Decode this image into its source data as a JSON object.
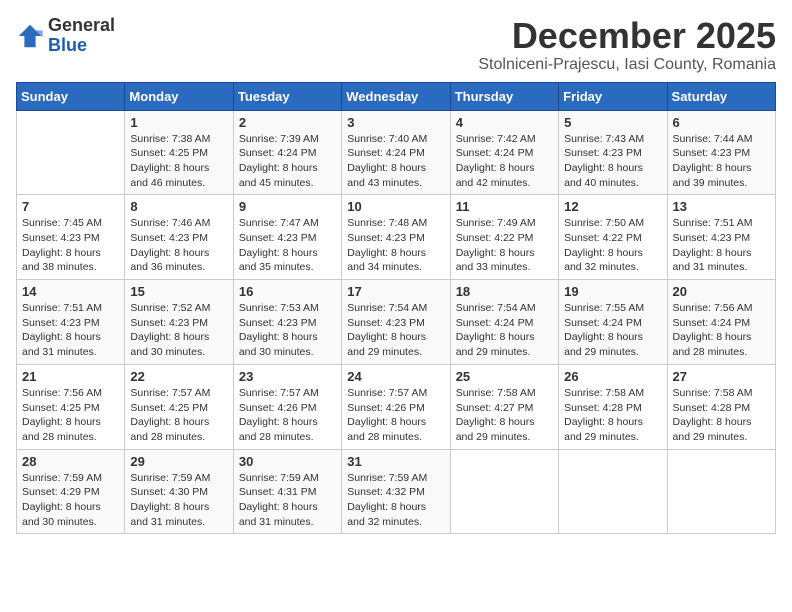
{
  "header": {
    "logo_general": "General",
    "logo_blue": "Blue",
    "month": "December 2025",
    "location": "Stolniceni-Prajescu, Iasi County, Romania"
  },
  "days_of_week": [
    "Sunday",
    "Monday",
    "Tuesday",
    "Wednesday",
    "Thursday",
    "Friday",
    "Saturday"
  ],
  "weeks": [
    [
      {
        "day": "",
        "info": ""
      },
      {
        "day": "1",
        "info": "Sunrise: 7:38 AM\nSunset: 4:25 PM\nDaylight: 8 hours\nand 46 minutes."
      },
      {
        "day": "2",
        "info": "Sunrise: 7:39 AM\nSunset: 4:24 PM\nDaylight: 8 hours\nand 45 minutes."
      },
      {
        "day": "3",
        "info": "Sunrise: 7:40 AM\nSunset: 4:24 PM\nDaylight: 8 hours\nand 43 minutes."
      },
      {
        "day": "4",
        "info": "Sunrise: 7:42 AM\nSunset: 4:24 PM\nDaylight: 8 hours\nand 42 minutes."
      },
      {
        "day": "5",
        "info": "Sunrise: 7:43 AM\nSunset: 4:23 PM\nDaylight: 8 hours\nand 40 minutes."
      },
      {
        "day": "6",
        "info": "Sunrise: 7:44 AM\nSunset: 4:23 PM\nDaylight: 8 hours\nand 39 minutes."
      }
    ],
    [
      {
        "day": "7",
        "info": "Sunrise: 7:45 AM\nSunset: 4:23 PM\nDaylight: 8 hours\nand 38 minutes."
      },
      {
        "day": "8",
        "info": "Sunrise: 7:46 AM\nSunset: 4:23 PM\nDaylight: 8 hours\nand 36 minutes."
      },
      {
        "day": "9",
        "info": "Sunrise: 7:47 AM\nSunset: 4:23 PM\nDaylight: 8 hours\nand 35 minutes."
      },
      {
        "day": "10",
        "info": "Sunrise: 7:48 AM\nSunset: 4:23 PM\nDaylight: 8 hours\nand 34 minutes."
      },
      {
        "day": "11",
        "info": "Sunrise: 7:49 AM\nSunset: 4:22 PM\nDaylight: 8 hours\nand 33 minutes."
      },
      {
        "day": "12",
        "info": "Sunrise: 7:50 AM\nSunset: 4:22 PM\nDaylight: 8 hours\nand 32 minutes."
      },
      {
        "day": "13",
        "info": "Sunrise: 7:51 AM\nSunset: 4:23 PM\nDaylight: 8 hours\nand 31 minutes."
      }
    ],
    [
      {
        "day": "14",
        "info": "Sunrise: 7:51 AM\nSunset: 4:23 PM\nDaylight: 8 hours\nand 31 minutes."
      },
      {
        "day": "15",
        "info": "Sunrise: 7:52 AM\nSunset: 4:23 PM\nDaylight: 8 hours\nand 30 minutes."
      },
      {
        "day": "16",
        "info": "Sunrise: 7:53 AM\nSunset: 4:23 PM\nDaylight: 8 hours\nand 30 minutes."
      },
      {
        "day": "17",
        "info": "Sunrise: 7:54 AM\nSunset: 4:23 PM\nDaylight: 8 hours\nand 29 minutes."
      },
      {
        "day": "18",
        "info": "Sunrise: 7:54 AM\nSunset: 4:24 PM\nDaylight: 8 hours\nand 29 minutes."
      },
      {
        "day": "19",
        "info": "Sunrise: 7:55 AM\nSunset: 4:24 PM\nDaylight: 8 hours\nand 29 minutes."
      },
      {
        "day": "20",
        "info": "Sunrise: 7:56 AM\nSunset: 4:24 PM\nDaylight: 8 hours\nand 28 minutes."
      }
    ],
    [
      {
        "day": "21",
        "info": "Sunrise: 7:56 AM\nSunset: 4:25 PM\nDaylight: 8 hours\nand 28 minutes."
      },
      {
        "day": "22",
        "info": "Sunrise: 7:57 AM\nSunset: 4:25 PM\nDaylight: 8 hours\nand 28 minutes."
      },
      {
        "day": "23",
        "info": "Sunrise: 7:57 AM\nSunset: 4:26 PM\nDaylight: 8 hours\nand 28 minutes."
      },
      {
        "day": "24",
        "info": "Sunrise: 7:57 AM\nSunset: 4:26 PM\nDaylight: 8 hours\nand 28 minutes."
      },
      {
        "day": "25",
        "info": "Sunrise: 7:58 AM\nSunset: 4:27 PM\nDaylight: 8 hours\nand 29 minutes."
      },
      {
        "day": "26",
        "info": "Sunrise: 7:58 AM\nSunset: 4:28 PM\nDaylight: 8 hours\nand 29 minutes."
      },
      {
        "day": "27",
        "info": "Sunrise: 7:58 AM\nSunset: 4:28 PM\nDaylight: 8 hours\nand 29 minutes."
      }
    ],
    [
      {
        "day": "28",
        "info": "Sunrise: 7:59 AM\nSunset: 4:29 PM\nDaylight: 8 hours\nand 30 minutes."
      },
      {
        "day": "29",
        "info": "Sunrise: 7:59 AM\nSunset: 4:30 PM\nDaylight: 8 hours\nand 31 minutes."
      },
      {
        "day": "30",
        "info": "Sunrise: 7:59 AM\nSunset: 4:31 PM\nDaylight: 8 hours\nand 31 minutes."
      },
      {
        "day": "31",
        "info": "Sunrise: 7:59 AM\nSunset: 4:32 PM\nDaylight: 8 hours\nand 32 minutes."
      },
      {
        "day": "",
        "info": ""
      },
      {
        "day": "",
        "info": ""
      },
      {
        "day": "",
        "info": ""
      }
    ]
  ]
}
